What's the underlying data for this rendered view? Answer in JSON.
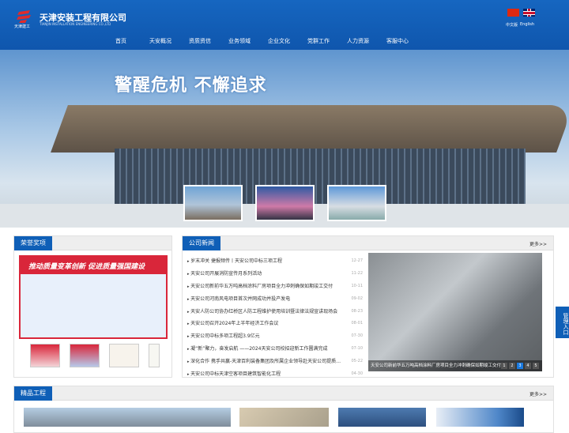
{
  "header": {
    "company_name": "天津安装工程有限公司",
    "company_name_en": "TIANJIN INSTALLATION ENGINEERING CO.,LTD",
    "logo_sub": "天津建工",
    "lang_cn": "中文版",
    "lang_en": "English"
  },
  "nav": [
    "首页",
    "天安概况",
    "资质资信",
    "业务领域",
    "企业文化",
    "党群工作",
    "人力资源",
    "客服中心"
  ],
  "banner": {
    "slogan": "警醒危机 不懈追求"
  },
  "honors": {
    "title": "荣誉奖项",
    "poster_text": "推动质量变革创新 促进质量强国建设"
  },
  "news": {
    "title": "公司新闻",
    "more": "更多>>",
    "items": [
      {
        "title": "岁末冲关 捷报频传丨天安公司中标三项工程",
        "date": "12-27"
      },
      {
        "title": "天安公司开展消防宣传月系列活动",
        "date": "11-22"
      },
      {
        "title": "天安公司新前华五万吨高档涂料厂房项目全力冲刺确保如期竣工交付",
        "date": "10-11"
      },
      {
        "title": "天安公司河南风电项目首次并网成功并投产发电",
        "date": "09-02"
      },
      {
        "title": "天安人防公司协办红桥区人防工程维护使用培训暨法律法规宣讲现场会",
        "date": "08-23"
      },
      {
        "title": "天安公司召开2024年上半年经济工作会议",
        "date": "08-01"
      },
      {
        "title": "天安公司中标多项工程超3.9亿元",
        "date": "07-30"
      },
      {
        "title": "凝“新”聚力，奋发启航 ——2024天安公司校招迎新工作圆满完成",
        "date": "07-10"
      },
      {
        "title": "深化合作 携手共赢-天津百利装备集团及所属企业领导赴天安公司提质…",
        "date": "05-22"
      },
      {
        "title": "天安公司中标天津空客项目建筑智能化工程",
        "date": "04-30"
      }
    ],
    "photo_caption": "天安公司新前华五万吨高档涂料厂房项目全力冲刺确保如期竣工交付",
    "pages": [
      "1",
      "2",
      "3",
      "4",
      "5"
    ],
    "active_page": 3
  },
  "admin": {
    "label": "管理入口"
  },
  "projects": {
    "title": "精品工程",
    "more": "更多>>"
  },
  "colors": {
    "brand": "#0f5fb7"
  }
}
